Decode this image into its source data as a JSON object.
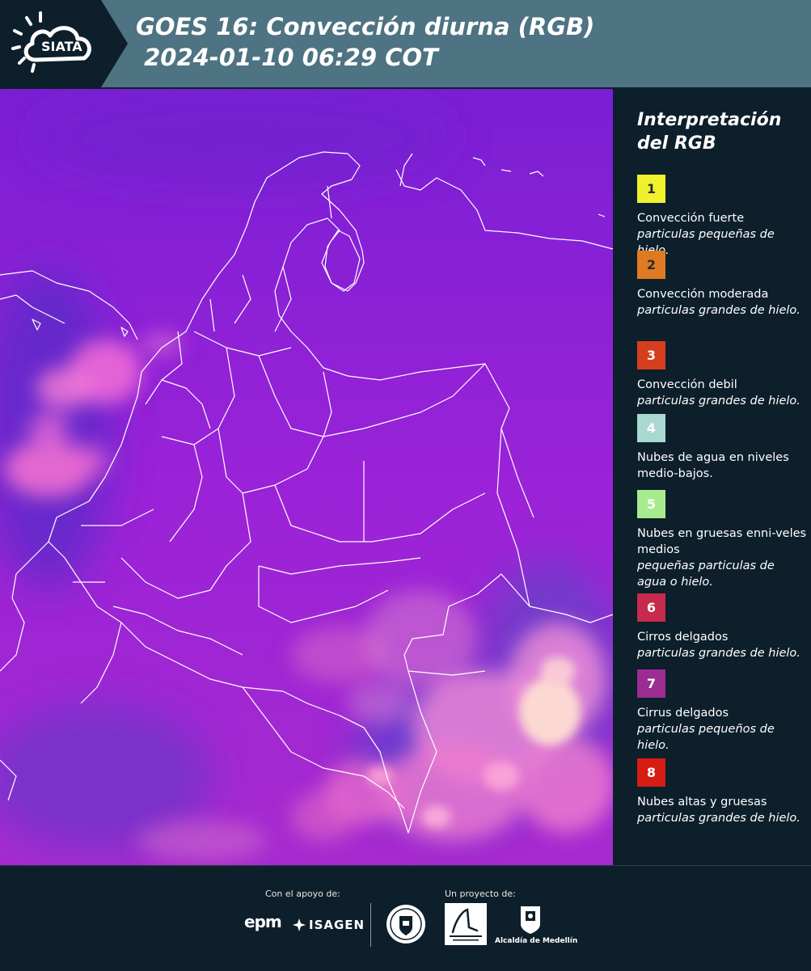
{
  "header": {
    "logo_text": "SIATA",
    "title_line1": "GOES 16: Convección diurna (RGB)",
    "title_line2": " 2024-01-10 06:29 COT"
  },
  "colors": {
    "header_bg": "#4e7382",
    "panel_bg": "#0d1f2b",
    "map_base": "#9a22d8"
  },
  "legend": {
    "title": "Interpretación del RGB",
    "items": [
      {
        "number": "1",
        "color": "#eef12c",
        "label": "Convección fuerte",
        "sub": "particulas pequeñas de hielo."
      },
      {
        "number": "2",
        "color": "#e07a22",
        "label": "Convección moderada",
        "sub": "particulas grandes de hielo."
      },
      {
        "number": "3",
        "color": "#d63e1e",
        "label": "Convección debil",
        "sub": "particulas grandes de hielo."
      },
      {
        "number": "4",
        "color": "#a9d7d2",
        "label": "Nubes de agua en niveles medio-bajos.",
        "sub": ""
      },
      {
        "number": "5",
        "color": "#a8eb8f",
        "label": "Nubes en gruesas enni-veles medios",
        "sub": "pequeñas particulas de agua o hielo."
      },
      {
        "number": "6",
        "color": "#c72a4c",
        "label": "Cirros delgados",
        "sub": "particulas grandes de hielo."
      },
      {
        "number": "7",
        "color": "#9c2c92",
        "label": "Cirrus delgados",
        "sub": "particulas pequeños de hielo."
      },
      {
        "number": "8",
        "color": "#d61d14",
        "label": "Nubes altas y gruesas",
        "sub": "particulas grandes de hielo."
      }
    ]
  },
  "footer": {
    "support_caption": "Con el apoyo de:",
    "project_caption": "Un proyecto de:",
    "epm_label": "epm",
    "isagen_label": "ISAGEN",
    "medellin_label": "Alcaldía de Medellín"
  }
}
